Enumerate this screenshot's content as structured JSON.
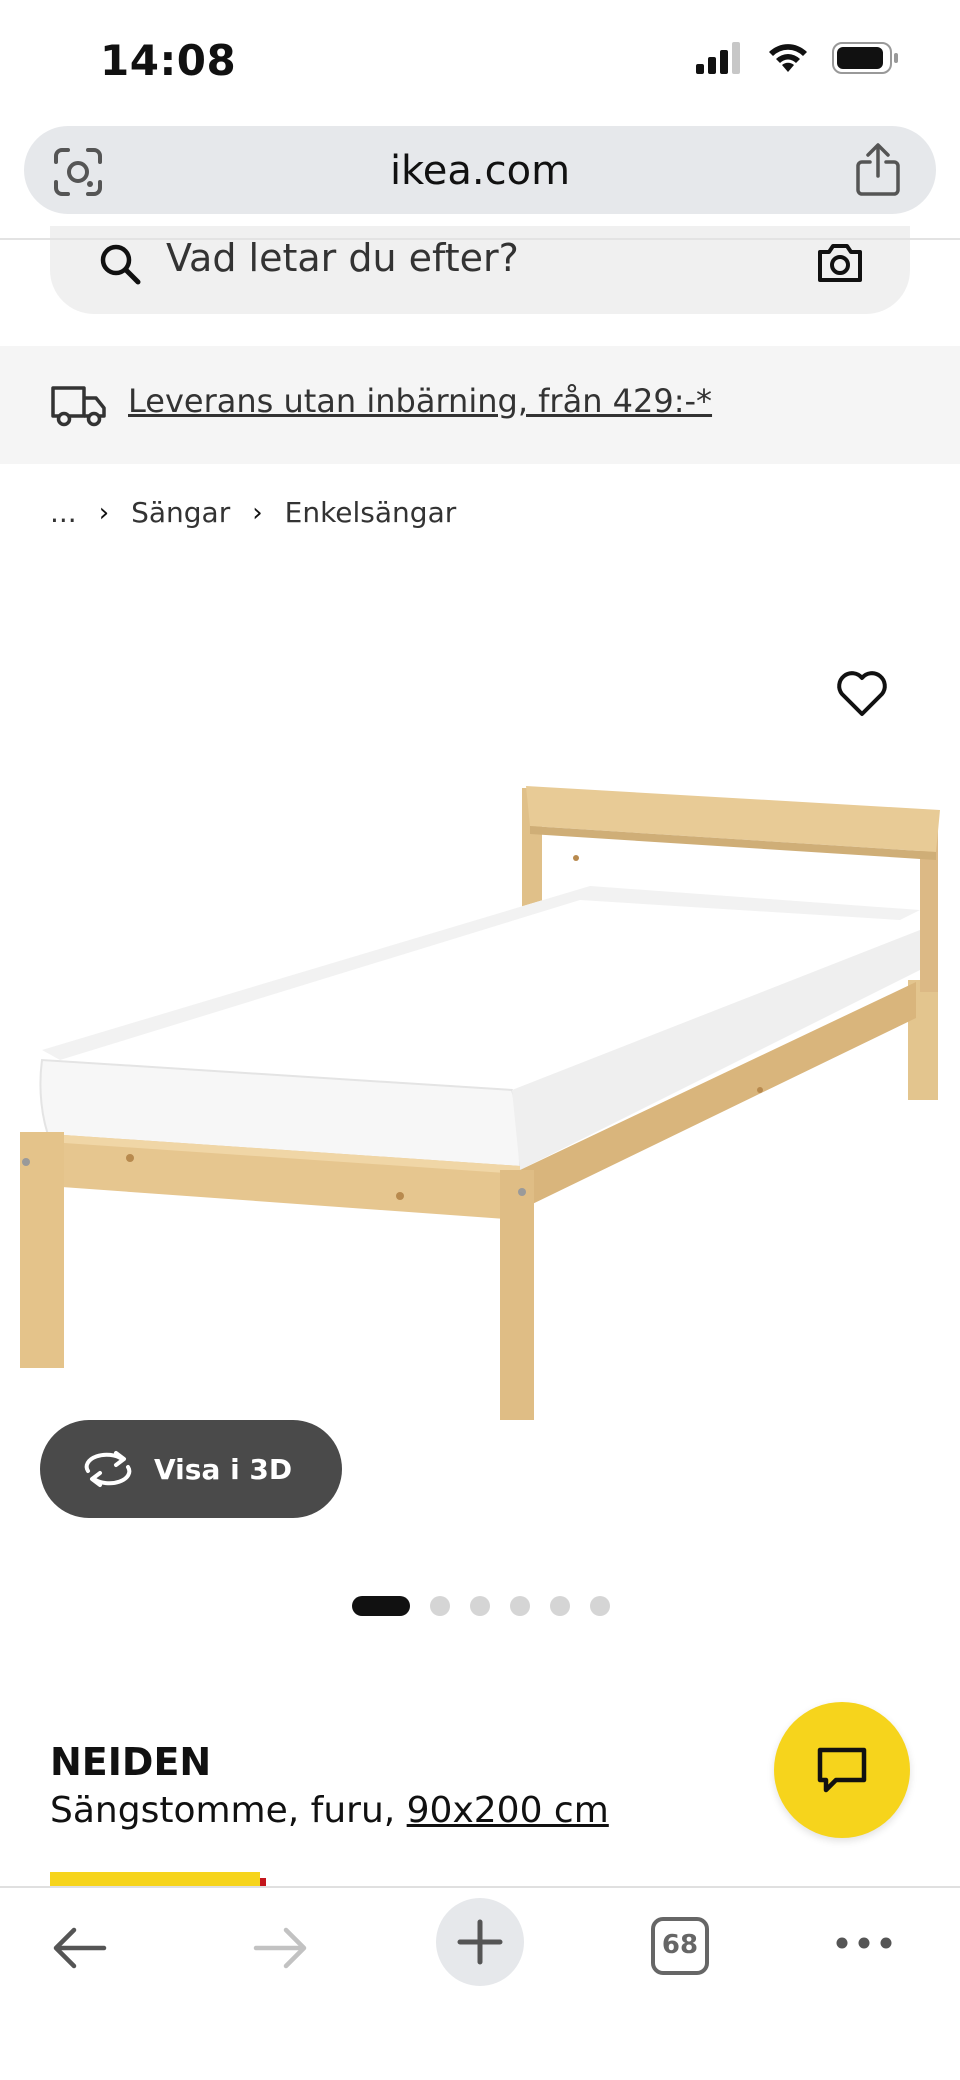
{
  "status": {
    "time": "14:08"
  },
  "browser": {
    "url": "ikea.com",
    "tab_count": "68"
  },
  "search": {
    "placeholder": "Vad letar du efter?"
  },
  "delivery": {
    "text": "Leverans utan inbärning, från 429:-*"
  },
  "breadcrumb": {
    "items": [
      "...",
      "Sängar",
      "Enkelsängar"
    ]
  },
  "product": {
    "name": "NEIDEN",
    "description": "Sängstomme, furu, ",
    "size": "90x200 cm",
    "view_3d_label": "Visa i 3D",
    "image_count": 6,
    "active_image": 1
  },
  "colors": {
    "brand_yellow": "#f6d41c",
    "dark_button": "#4a4a4a"
  }
}
